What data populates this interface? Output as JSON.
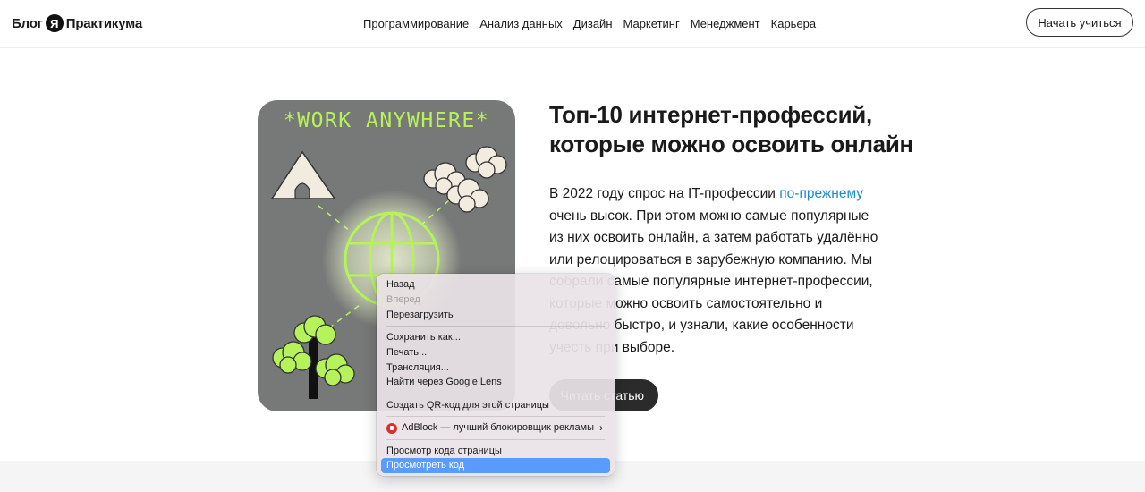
{
  "header": {
    "logo_left": "Блог",
    "logo_mark": "Я",
    "logo_right": "Практикума",
    "nav": [
      "Программирование",
      "Анализ данных",
      "Дизайн",
      "Маркетинг",
      "Менеджмент",
      "Карьера"
    ],
    "cta": "Начать учиться"
  },
  "hero": {
    "image_text": "*WORK ANYWHERE*",
    "title": "Топ-10 интернет-профессий, которые можно освоить онлайн",
    "lead_before": "В 2022 году спрос на IT-профессии ",
    "lead_link": "по-прежнему",
    "lead_after": " очень высок. При этом можно самые популярные из них освоить онлайн, а затем работать удалённо или релоцироваться в зарубежную компанию.  Мы собрали самые популярные интернет-профессии, которые можно освоить самостоятельно и довольно быстро, и узнали, какие особенности учесть при выборе.",
    "read_button": "Читать статью"
  },
  "context_menu": {
    "back": "Назад",
    "forward": "Вперед",
    "reload": "Перезагрузить",
    "save_as": "Сохранить как...",
    "print": "Печать...",
    "cast": "Трансляция...",
    "lens": "Найти через Google Lens",
    "qr": "Создать QR-код для этой страницы",
    "adblock": "AdBlock — лучший блокировщик рекламы",
    "view_source": "Просмотр кода страницы",
    "inspect": "Просмотреть код"
  }
}
